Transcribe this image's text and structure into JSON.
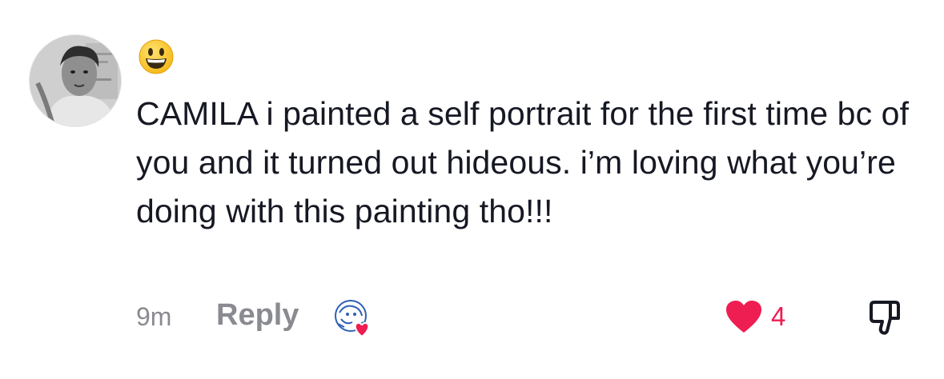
{
  "comment": {
    "emoji": "😃",
    "text": "CAMILA i painted a self portrait for the first time bc of you and it turned out hideous. i’m loving what you’re doing with this painting tho!!!",
    "timestamp": "9m",
    "reply_label": "Reply",
    "like_count": "4",
    "icons": {
      "avatar": "user-avatar",
      "creator_liked": "creator-liked-badge-icon",
      "like": "heart-icon",
      "dislike": "thumbs-down-icon"
    },
    "colors": {
      "text": "#161823",
      "meta": "#8a8b91",
      "like": "#ee1d52"
    }
  }
}
